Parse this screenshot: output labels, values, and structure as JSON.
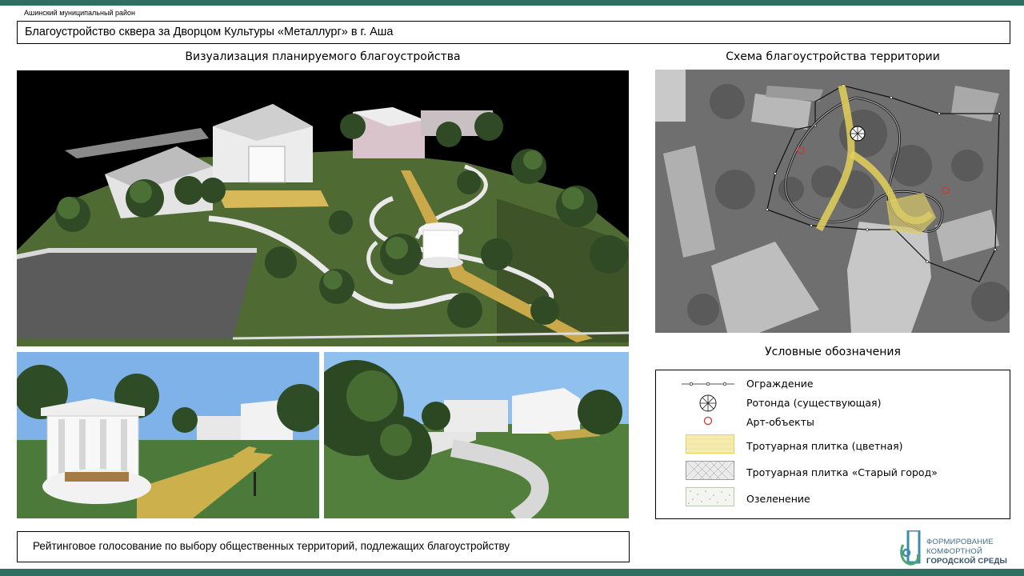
{
  "header": {
    "district": "Ашинский  муниципальный  район",
    "title": "Благоустройство сквера за Дворцом Культуры «Металлург» в г. Аша"
  },
  "visualization": {
    "heading": "Визуализация планируемого благоустройства"
  },
  "scheme": {
    "heading": "Схема благоустройства территории"
  },
  "legend": {
    "heading": "Условные обозначения",
    "items": [
      {
        "icon": "fence-line-icon",
        "label": "Ограждение"
      },
      {
        "icon": "rotunda-icon",
        "label": "Ротонда (существующая)"
      },
      {
        "icon": "art-object-circle-icon",
        "label": "Арт-объекты"
      },
      {
        "icon": "colored-paving-swatch-icon",
        "label": "Тротуарная плитка (цветная)"
      },
      {
        "icon": "old-town-paving-swatch-icon",
        "label": "Тротуарная плитка «Старый город»"
      },
      {
        "icon": "greenery-swatch-icon",
        "label": "Озеленение"
      }
    ]
  },
  "footer": {
    "vote_text": "Рейтинговое голосование по выбору общественных территорий, подлежащих  благоустройству"
  },
  "logo": {
    "line1": "ФОРМИРОВАНИЕ",
    "line2": "КОМФОРТНОЙ",
    "line3": "ГОРОДСКОЙ СРЕДЫ"
  },
  "colors": {
    "accent_bar": "#2d7062",
    "paving_yellow": "#e8d36a",
    "art_object_red": "#d0343a",
    "logo_blue": "#3d6f86"
  }
}
